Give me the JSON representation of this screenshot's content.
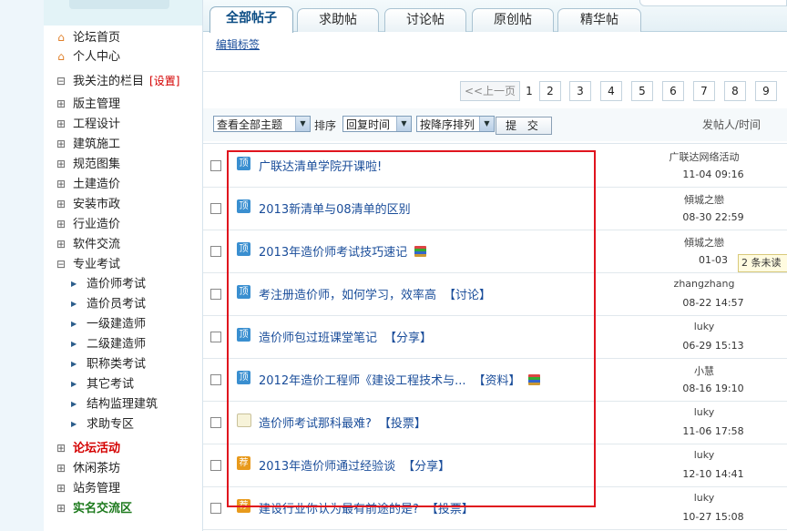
{
  "sidebar": {
    "home": "论坛首页",
    "personal": "个人中心",
    "followed": "我关注的栏目",
    "settings": "[设置]",
    "categories": [
      "版主管理",
      "工程设计",
      "建筑施工",
      "规范图集",
      "土建造价",
      "安装市政",
      "行业造价",
      "软件交流"
    ],
    "exam": "专业考试",
    "exam_subs": [
      "造价师考试",
      "造价员考试",
      "一级建造师",
      "二级建造师",
      "职称类考试",
      "其它考试",
      "结构监理建筑",
      "求助专区"
    ],
    "activity": "论坛活动",
    "teahouse": "休闲茶坊",
    "admin": "站务管理",
    "realname": "实名交流区"
  },
  "tabs": [
    "全部帖子",
    "求助帖",
    "讨论帖",
    "原创帖",
    "精华帖"
  ],
  "edit_tags": "编辑标签",
  "pager": {
    "prev": "<<上一页",
    "pages": [
      "1",
      "2",
      "3",
      "4",
      "5",
      "6",
      "7",
      "8",
      "9"
    ]
  },
  "filter": {
    "view": "查看全部主题",
    "sort_label": "排序",
    "sort_by": "回复时间",
    "order": "按降序排列",
    "submit": "提 交",
    "author_col": "发帖人/时间"
  },
  "unread_tip": "2 条未读",
  "badges": {
    "top": "顶",
    "rec": "荐"
  },
  "posts": [
    {
      "badge": "top",
      "title": "广联达清单学院开课啦!",
      "tag": "",
      "books": false,
      "author": "广联达网络活动",
      "time": "11-04 09:16"
    },
    {
      "badge": "top",
      "title": "2013新清单与08清单的区别",
      "tag": "",
      "books": false,
      "author": "傾城之戀",
      "time": "08-30 22:59"
    },
    {
      "badge": "top",
      "title": "2013年造价师考试技巧速记",
      "tag": "",
      "books": true,
      "author": "傾城之戀",
      "time": "01-03"
    },
    {
      "badge": "top",
      "title": "考注册造价师，如何学习，效率高",
      "tag": "【讨论】",
      "books": false,
      "author": "zhangzhang",
      "time": "08-22 14:57"
    },
    {
      "badge": "top",
      "title": "造价师包过班课堂笔记",
      "tag": "【分享】",
      "books": false,
      "author": "luky",
      "time": "06-29 15:13"
    },
    {
      "badge": "top",
      "title": "2012年造价工程师《建设工程技术与...",
      "tag": "【资料】",
      "books": true,
      "author": "小慧",
      "time": "08-16 19:10"
    },
    {
      "badge": "doc",
      "title": "造价师考试那科最难?",
      "tag": "【投票】",
      "books": false,
      "author": "luky",
      "time": "11-06 17:58"
    },
    {
      "badge": "rec",
      "title": "2013年造价师通过经验谈",
      "tag": "【分享】",
      "books": false,
      "author": "luky",
      "time": "12-10 14:41"
    },
    {
      "badge": "rec",
      "title": "建设行业你认为最有前途的是?",
      "tag": "【投票】",
      "books": false,
      "author": "luky",
      "time": "10-27 15:08"
    }
  ]
}
